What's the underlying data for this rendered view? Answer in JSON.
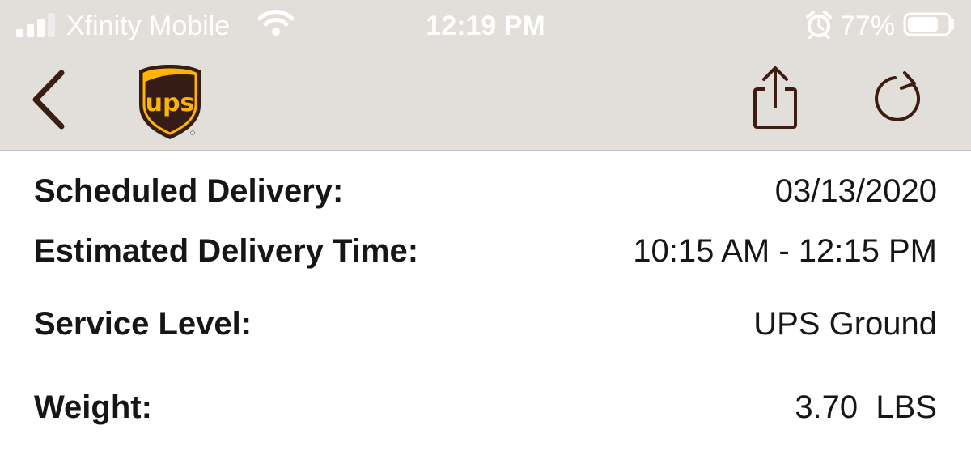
{
  "status_bar": {
    "carrier": "Xfinity Mobile",
    "time": "12:19 PM",
    "battery_percent": "77%",
    "battery_level": 0.77,
    "signal_bars_filled": 3,
    "signal_bars_total": 4,
    "icons": [
      "signal-icon",
      "wifi-icon",
      "alarm-icon",
      "battery-icon"
    ]
  },
  "nav_bar": {
    "icons": [
      "chevron-left-icon",
      "ups-logo",
      "share-icon",
      "refresh-icon"
    ],
    "logo_text": "ups",
    "accent_color": "#3b1d12",
    "logo_brown": "#351c15",
    "logo_gold": "#ffb500"
  },
  "details": [
    {
      "label": "Scheduled Delivery:",
      "value": "03/13/2020"
    },
    {
      "label": "Estimated Delivery Time:",
      "value": "10:15 AM - 12:15 PM"
    },
    {
      "label": "Service Level:",
      "value": "UPS Ground"
    },
    {
      "label": "Weight:",
      "value": "3.70  LBS"
    }
  ],
  "colors": {
    "header_background": "#e2dfda",
    "status_text": "#ffffff",
    "body_text": "#161616"
  }
}
